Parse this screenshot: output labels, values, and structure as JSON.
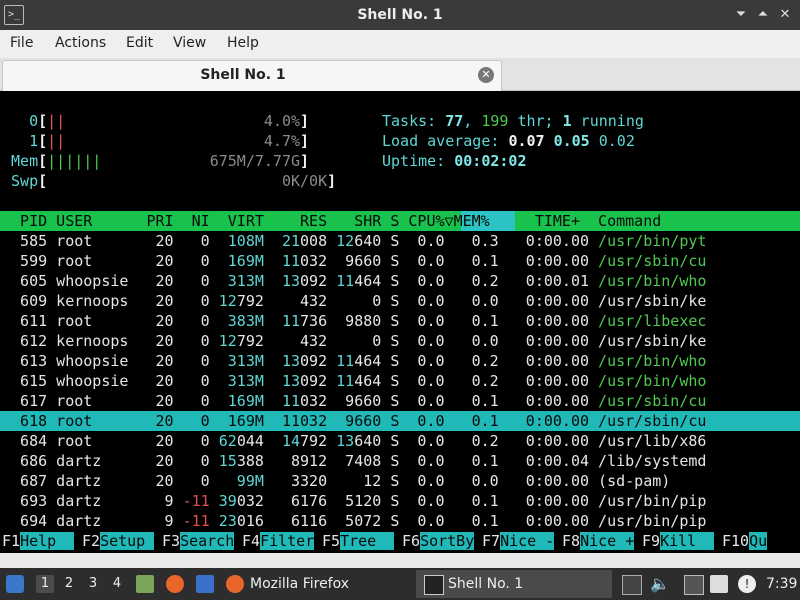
{
  "window": {
    "title": "Shell No. 1",
    "app_icon": ">_",
    "buttons": [
      "⏷",
      "⏶",
      "✕"
    ]
  },
  "menu": [
    "File",
    "Actions",
    "Edit",
    "View",
    "Help"
  ],
  "tab": {
    "label": "Shell No. 1",
    "close": "✕"
  },
  "meters": {
    "cpu0": {
      "label": "0",
      "bar": "||",
      "value": "4.0%"
    },
    "cpu1": {
      "label": "1",
      "bar": "||",
      "value": "4.7%"
    },
    "mem": {
      "label": "Mem",
      "bar": "||||||",
      "value": "675M/7.77G"
    },
    "swp": {
      "label": "Swp",
      "bar": "",
      "value": "0K/0K"
    }
  },
  "summary": {
    "tasks_label": "Tasks: ",
    "tasks": "77",
    "threads": "199",
    "thr_label": " thr; ",
    "running": "1",
    "running_label": " running",
    "load_label": "Load average: ",
    "load1": "0.07",
    "load5": "0.05",
    "load15": "0.02",
    "uptime_label": "Uptime: ",
    "uptime": "00:02:02"
  },
  "columns": [
    "PID",
    "USER",
    "PRI",
    "NI",
    "VIRT",
    "RES",
    "SHR",
    "S",
    "CPU%▽",
    "MEM%",
    "TIME+",
    "Command"
  ],
  "processes": [
    {
      "pid": "585",
      "user": "root",
      "pri": "20",
      "ni": "0",
      "virt": "108M",
      "res": "21008",
      "shr": "12640",
      "s": "S",
      "cpu": "0.0",
      "mem": "0.3",
      "time": "0:00.00",
      "cmd": "/usr/bin/pyt"
    },
    {
      "pid": "599",
      "user": "root",
      "pri": "20",
      "ni": "0",
      "virt": "169M",
      "res": "11032",
      "shr": "9660",
      "s": "S",
      "cpu": "0.0",
      "mem": "0.1",
      "time": "0:00.00",
      "cmd": "/usr/sbin/cu"
    },
    {
      "pid": "605",
      "user": "whoopsie",
      "pri": "20",
      "ni": "0",
      "virt": "313M",
      "res": "13092",
      "shr": "11464",
      "s": "S",
      "cpu": "0.0",
      "mem": "0.2",
      "time": "0:00.01",
      "cmd": "/usr/bin/who"
    },
    {
      "pid": "609",
      "user": "kernoops",
      "pri": "20",
      "ni": "0",
      "virt": "12792",
      "res": "432",
      "shr": "0",
      "s": "S",
      "cpu": "0.0",
      "mem": "0.0",
      "time": "0:00.00",
      "cmd": "/usr/sbin/ke"
    },
    {
      "pid": "611",
      "user": "root",
      "pri": "20",
      "ni": "0",
      "virt": "383M",
      "res": "11736",
      "shr": "9880",
      "s": "S",
      "cpu": "0.0",
      "mem": "0.1",
      "time": "0:00.00",
      "cmd": "/usr/libexec"
    },
    {
      "pid": "612",
      "user": "kernoops",
      "pri": "20",
      "ni": "0",
      "virt": "12792",
      "res": "432",
      "shr": "0",
      "s": "S",
      "cpu": "0.0",
      "mem": "0.0",
      "time": "0:00.00",
      "cmd": "/usr/sbin/ke"
    },
    {
      "pid": "613",
      "user": "whoopsie",
      "pri": "20",
      "ni": "0",
      "virt": "313M",
      "res": "13092",
      "shr": "11464",
      "s": "S",
      "cpu": "0.0",
      "mem": "0.2",
      "time": "0:00.00",
      "cmd": "/usr/bin/who"
    },
    {
      "pid": "615",
      "user": "whoopsie",
      "pri": "20",
      "ni": "0",
      "virt": "313M",
      "res": "13092",
      "shr": "11464",
      "s": "S",
      "cpu": "0.0",
      "mem": "0.2",
      "time": "0:00.00",
      "cmd": "/usr/bin/who"
    },
    {
      "pid": "617",
      "user": "root",
      "pri": "20",
      "ni": "0",
      "virt": "169M",
      "res": "11032",
      "shr": "9660",
      "s": "S",
      "cpu": "0.0",
      "mem": "0.1",
      "time": "0:00.00",
      "cmd": "/usr/sbin/cu"
    },
    {
      "pid": "618",
      "user": "root",
      "pri": "20",
      "ni": "0",
      "virt": "169M",
      "res": "11032",
      "shr": "9660",
      "s": "S",
      "cpu": "0.0",
      "mem": "0.1",
      "time": "0:00.00",
      "cmd": "/usr/sbin/cu",
      "selected": true
    },
    {
      "pid": "684",
      "user": "root",
      "pri": "20",
      "ni": "0",
      "virt": "62044",
      "res": "14792",
      "shr": "13640",
      "s": "S",
      "cpu": "0.0",
      "mem": "0.2",
      "time": "0:00.00",
      "cmd": "/usr/lib/x86"
    },
    {
      "pid": "686",
      "user": "dartz",
      "pri": "20",
      "ni": "0",
      "virt": "15388",
      "res": "8912",
      "shr": "7408",
      "s": "S",
      "cpu": "0.0",
      "mem": "0.1",
      "time": "0:00.04",
      "cmd": "/lib/systemd"
    },
    {
      "pid": "687",
      "user": "dartz",
      "pri": "20",
      "ni": "0",
      "virt": "99M",
      "res": "3320",
      "shr": "12",
      "s": "S",
      "cpu": "0.0",
      "mem": "0.0",
      "time": "0:00.00",
      "cmd": "(sd-pam)"
    },
    {
      "pid": "693",
      "user": "dartz",
      "pri": "9",
      "ni": "-11",
      "virt": "39032",
      "res": "6176",
      "shr": "5120",
      "s": "S",
      "cpu": "0.0",
      "mem": "0.1",
      "time": "0:00.00",
      "cmd": "/usr/bin/pip"
    },
    {
      "pid": "694",
      "user": "dartz",
      "pri": "9",
      "ni": "-11",
      "virt": "23016",
      "res": "6116",
      "shr": "5072",
      "s": "S",
      "cpu": "0.0",
      "mem": "0.1",
      "time": "0:00.00",
      "cmd": "/usr/bin/pip"
    }
  ],
  "fkeys": [
    {
      "key": "F1",
      "action": "Help  "
    },
    {
      "key": "F2",
      "action": "Setup "
    },
    {
      "key": "F3",
      "action": "Search"
    },
    {
      "key": "F4",
      "action": "Filter"
    },
    {
      "key": "F5",
      "action": "Tree  "
    },
    {
      "key": "F6",
      "action": "SortBy"
    },
    {
      "key": "F7",
      "action": "Nice -"
    },
    {
      "key": "F8",
      "action": "Nice +"
    },
    {
      "key": "F9",
      "action": "Kill  "
    },
    {
      "key": "F10",
      "action": "Qu"
    }
  ],
  "taskbar": {
    "workspaces": [
      "1",
      "2",
      "3",
      "4"
    ],
    "firefox_label": "Mozilla Firefox",
    "terminal_label": "Shell No. 1",
    "clock": "7:39"
  },
  "colors": {
    "header_bar": "#18c24c",
    "selection": "#21b8b8",
    "cyan_text": "#5fd7d7",
    "green_text": "#4ec94e",
    "red_text": "#e05050"
  }
}
